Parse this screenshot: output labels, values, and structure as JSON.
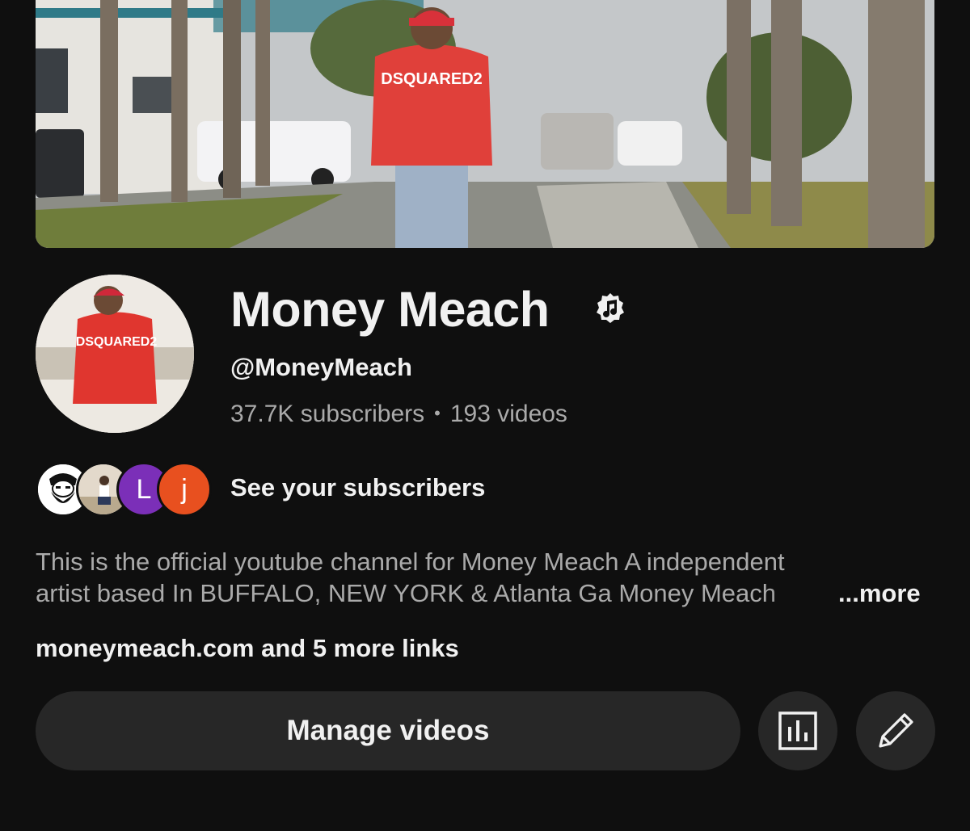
{
  "channel": {
    "name": "Money Meach",
    "handle": "@MoneyMeach",
    "subscribers": "37.7K subscribers",
    "separator": "•",
    "videos": "193 videos",
    "verified_icon": "music-note-badge"
  },
  "subscribers_preview": {
    "label": "See your subscribers",
    "avatars": [
      {
        "kind": "image",
        "description_icon": "bearded-man-logo"
      },
      {
        "kind": "image",
        "description_icon": "person-photo"
      },
      {
        "kind": "letter",
        "letter": "L",
        "color": "#7b2fb8"
      },
      {
        "kind": "letter",
        "letter": "j",
        "color": "#e8501f"
      }
    ]
  },
  "description": {
    "line1": "This is the official youtube channel for Money Meach  A independent",
    "line2": "artist based In BUFFALO, NEW YORK & Atlanta Ga Money Meach",
    "more_label": "...more"
  },
  "links": {
    "label": "moneymeach.com and 5 more links"
  },
  "actions": {
    "manage_label": "Manage videos",
    "analytics_icon": "analytics-icon",
    "edit_icon": "pencil-icon"
  },
  "colors": {
    "background": "#0f0f0f",
    "button_bg": "#272727",
    "secondary_text": "#aaaaaa",
    "primary_text": "#f1f1f1"
  }
}
